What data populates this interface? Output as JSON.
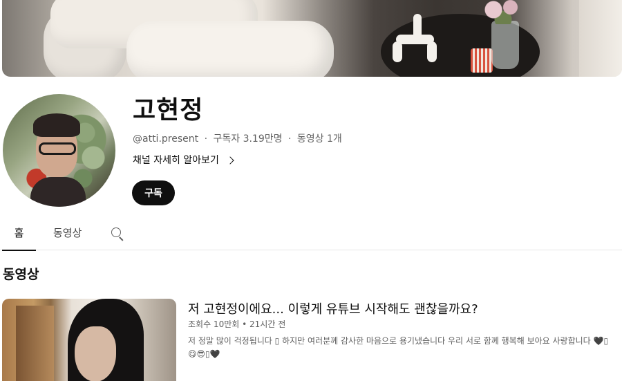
{
  "channel": {
    "name": "고현정",
    "handle": "@atti.present",
    "subscribers": "구독자 3.19만명",
    "video_count": "동영상 1개",
    "separator": "·",
    "more_label": "채널 자세히 알아보기",
    "subscribe_label": "구독"
  },
  "tabs": {
    "home": "홈",
    "videos": "동영상"
  },
  "section": {
    "title": "동영상"
  },
  "video": {
    "title": "저 고현정이에요... 이렇게 유튜브 시작해도 괜찮을까요?",
    "views": "조회수 10만회",
    "stats_separator": "•",
    "age": "21시간 전",
    "description": "저 정말 많이 걱정됩니다 ▯ 하지만 여러분께 감사한 마음으로 용기냈습니다 우리 서로 함께 행복해 보아요 사랑합니다 🖤▯😋😎▯🖤"
  },
  "icons": {
    "search": "search-icon",
    "chevron": "chevron-right-icon"
  }
}
